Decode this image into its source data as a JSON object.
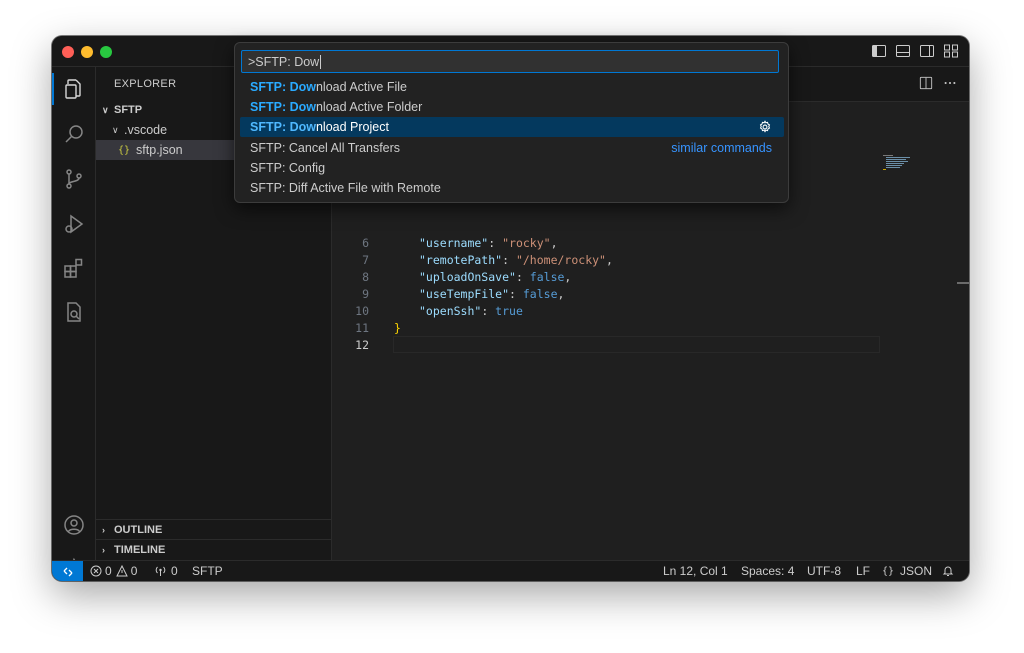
{
  "sidebar": {
    "title": "EXPLORER",
    "root_folder": "SFTP",
    "subfolder": ".vscode",
    "file": "sftp.json",
    "file_icon": "{}",
    "outline": "OUTLINE",
    "timeline": "TIMELINE"
  },
  "editor": {
    "lines": [
      {
        "n": "6",
        "key": "\"username\"",
        "value": "\"rocky\"",
        "vtype": "s",
        "tail": ","
      },
      {
        "n": "7",
        "key": "\"remotePath\"",
        "value": "\"/home/rocky\"",
        "vtype": "s",
        "tail": ","
      },
      {
        "n": "8",
        "key": "\"uploadOnSave\"",
        "value": "false",
        "vtype": "b",
        "tail": ","
      },
      {
        "n": "9",
        "key": "\"useTempFile\"",
        "value": "false",
        "vtype": "b",
        "tail": ","
      },
      {
        "n": "10",
        "key": "\"openSsh\"",
        "value": "true",
        "vtype": "b",
        "tail": ""
      }
    ],
    "line11_num": "11",
    "line11_text": "}",
    "line12_num": "12",
    "colon": ": "
  },
  "palette": {
    "input_value": ">SFTP: Dow",
    "items": [
      {
        "highlight": "SFTP: Dow",
        "rest": "nload Active File"
      },
      {
        "highlight": "SFTP: Dow",
        "rest": "nload Active Folder"
      },
      {
        "highlight": "SFTP: Dow",
        "rest": "nload Project"
      },
      {
        "highlight": "",
        "rest": "SFTP: Cancel All Transfers"
      },
      {
        "highlight": "",
        "rest": "SFTP: Config"
      },
      {
        "highlight": "",
        "rest": "SFTP: Diff Active File with Remote"
      }
    ],
    "similar_commands": "similar commands",
    "active_index": 2
  },
  "statusbar": {
    "errors": "0",
    "warnings": "0",
    "ports": "0",
    "sftp": "SFTP",
    "position": "Ln 12, Col 1",
    "spaces": "Spaces: 4",
    "encoding": "UTF-8",
    "eol": "LF",
    "language_icon": "{}",
    "language": "JSON"
  },
  "icons": {
    "activity": [
      "explorer-icon",
      "search-icon",
      "source-control-icon",
      "run-debug-icon",
      "extensions-icon",
      "remote-explorer-icon",
      "account-icon",
      "settings-gear-icon"
    ]
  },
  "colors": {
    "accent": "#0078d4",
    "highlight": "#2aaaff",
    "active_row": "#04395e"
  }
}
